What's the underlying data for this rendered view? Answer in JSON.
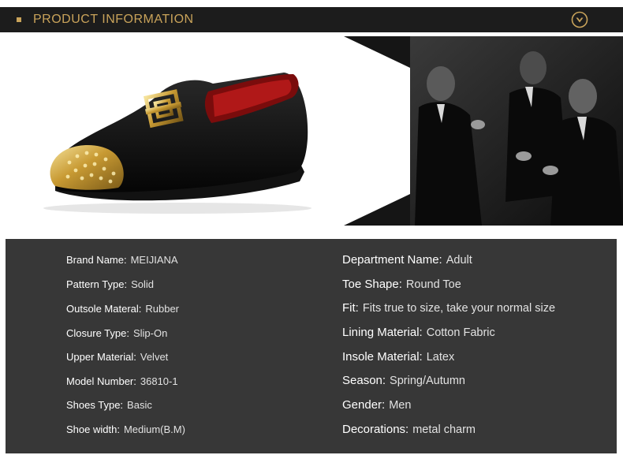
{
  "header": {
    "title": "PRODUCT INFORMATION",
    "accent_color": "#c9a35a",
    "bar_color": "#1c1c1c",
    "toggle_icon": "chevron-down-circle-icon"
  },
  "images": {
    "product": "black velvet loafer with gold metal toe cap and gold buckle charm",
    "lifestyle": "black and white photo of men in suits"
  },
  "specs": {
    "left": [
      {
        "label": "Brand Name:",
        "value": "MEIJIANA"
      },
      {
        "label": "Pattern Type:",
        "value": "Solid"
      },
      {
        "label": "Outsole Materal:",
        "value": "Rubber"
      },
      {
        "label": "Closure Type:",
        "value": "Slip-On"
      },
      {
        "label": "Upper Material:",
        "value": "Velvet"
      },
      {
        "label": "Model Number:",
        "value": "36810-1"
      },
      {
        "label": "Shoes Type:",
        "value": "Basic"
      },
      {
        "label": "Shoe width:",
        "value": "Medium(B.M)"
      }
    ],
    "right": [
      {
        "label": "Department Name:",
        "value": "Adult"
      },
      {
        "label": "Toe Shape:",
        "value": "Round Toe"
      },
      {
        "label": "Fit:",
        "value": "Fits true to size, take your normal size"
      },
      {
        "label": "Lining Material:",
        "value": "Cotton Fabric"
      },
      {
        "label": "Insole Material:",
        "value": "Latex"
      },
      {
        "label": "Season:",
        "value": "Spring/Autumn"
      },
      {
        "label": "Gender:",
        "value": "Men"
      },
      {
        "label": "Decorations:",
        "value": "metal charm"
      }
    ]
  }
}
